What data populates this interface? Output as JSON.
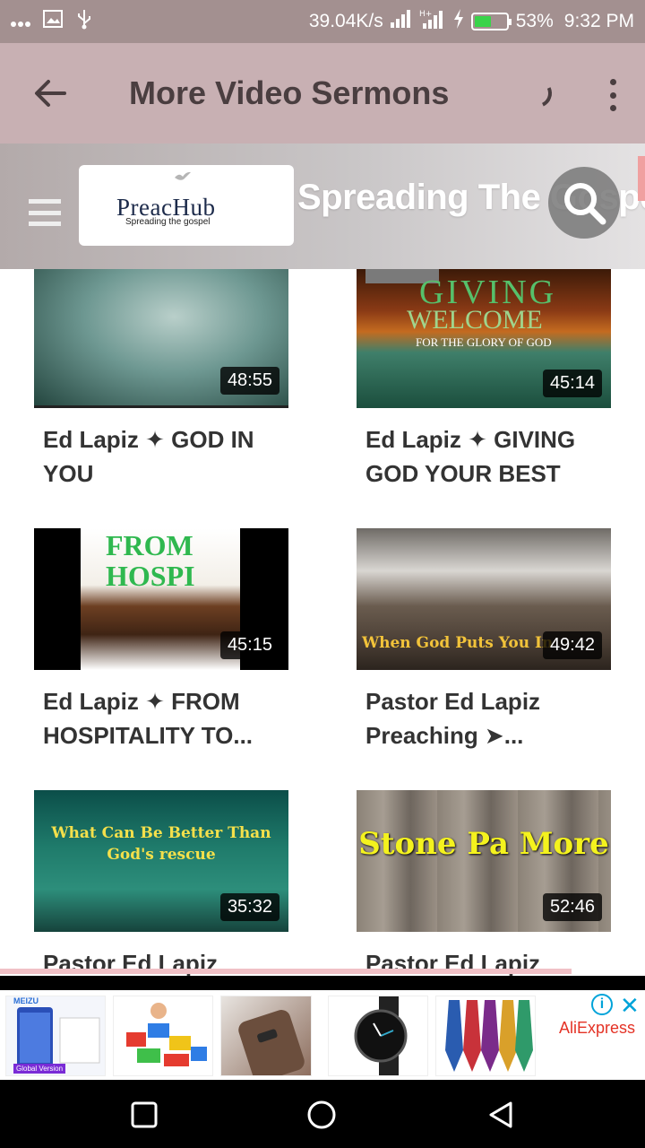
{
  "status_bar": {
    "left_icons": [
      "more-icon",
      "image-icon",
      "usb-icon"
    ],
    "speed": "39.04K/s",
    "battery": "53%",
    "battery_level": 0.53,
    "time": "9:32 PM"
  },
  "app_bar": {
    "title": "More Video Sermons"
  },
  "web_header": {
    "logo_text": "PreacHub",
    "logo_tagline": "Spreading the gospel",
    "tagline": "Spreading The Gospel"
  },
  "videos": [
    {
      "title": "Ed Lapiz ✦ GOD IN YOU",
      "duration": "48:55"
    },
    {
      "title": "Ed Lapiz ✦ GIVING GOD YOUR BEST",
      "duration": "45:14",
      "thumb_text": [
        "GIVING",
        "WELCOME",
        "FOR THE GLORY OF GOD"
      ]
    },
    {
      "title": "Ed Lapiz ✦ FROM HOSPITALITY TO...",
      "duration": "45:15",
      "thumb_text": "FROM HOSPI"
    },
    {
      "title": "Pastor Ed Lapiz Preaching ➤...",
      "duration": "49:42",
      "thumb_text": "When God Puts You In"
    },
    {
      "title": "Pastor Ed Lapiz",
      "duration": "35:32",
      "thumb_text": "What Can Be Better Than God's rescue"
    },
    {
      "title": "Pastor Ed Lapiz",
      "duration": "52:46",
      "thumb_text": "Stone Pa More"
    }
  ],
  "ad": {
    "brand": "AliExpress",
    "info_glyph": "i",
    "close_glyph": "✕",
    "items": [
      "meizu-phone",
      "toy-blocks",
      "phone-case",
      "wrist-watch",
      "neckties"
    ],
    "meizu_label": "MEIZU",
    "meizu_badge": "Global Version"
  },
  "nav": [
    "recents-button",
    "home-button",
    "back-button"
  ]
}
